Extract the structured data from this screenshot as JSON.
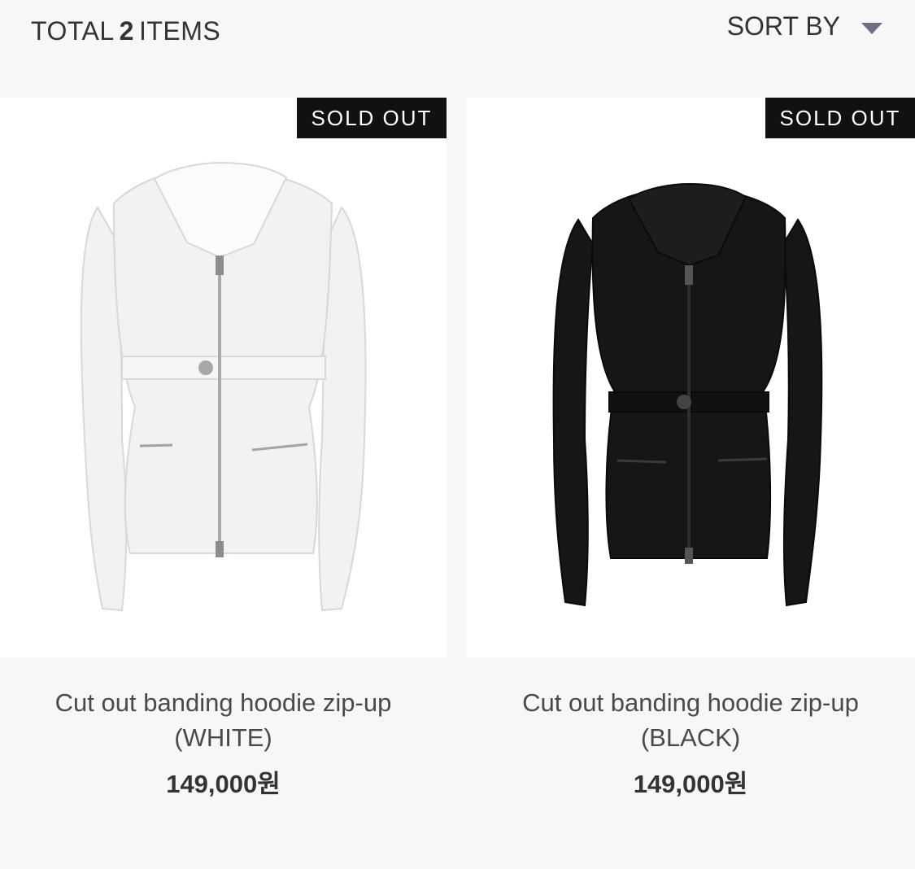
{
  "header": {
    "total_prefix": "TOTAL",
    "total_count": "2",
    "total_suffix": "ITEMS",
    "sort_label": "SORT BY",
    "sort_icon": "caret-down-icon"
  },
  "products": [
    {
      "badge": "SOLD OUT",
      "name_line1": "Cut out banding hoodie zip-up",
      "name_line2": "(WHITE)",
      "price": "149,000원",
      "color": "#ffffff"
    },
    {
      "badge": "SOLD OUT",
      "name_line1": "Cut out banding hoodie zip-up",
      "name_line2": "(BLACK)",
      "price": "149,000원",
      "color": "#111111"
    }
  ]
}
